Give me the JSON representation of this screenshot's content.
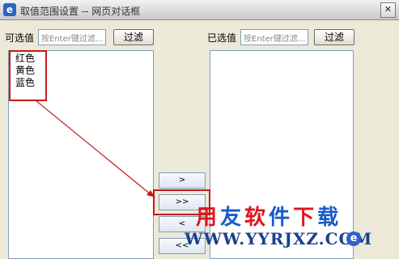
{
  "window": {
    "title": "取值范围设置 -- 网页对话框",
    "close_label": "✕",
    "app_icon": "e"
  },
  "available": {
    "label": "可选值",
    "filter_placeholder": "按Enter键过滤...",
    "filter_button": "过滤",
    "items": [
      "红色",
      "黄色",
      "蓝色"
    ]
  },
  "selected": {
    "label": "已选值",
    "filter_placeholder": "按Enter键过滤...",
    "filter_button": "过滤",
    "items": []
  },
  "move_buttons": [
    ">",
    ">>",
    "<",
    "<<"
  ],
  "annotation": {
    "color": "#c41a1a"
  },
  "watermark": {
    "brand_chars": [
      "用",
      "友",
      "软",
      "件",
      "下",
      "载"
    ],
    "url": "WWW.YYRJXZ.COM",
    "logo": "e"
  }
}
